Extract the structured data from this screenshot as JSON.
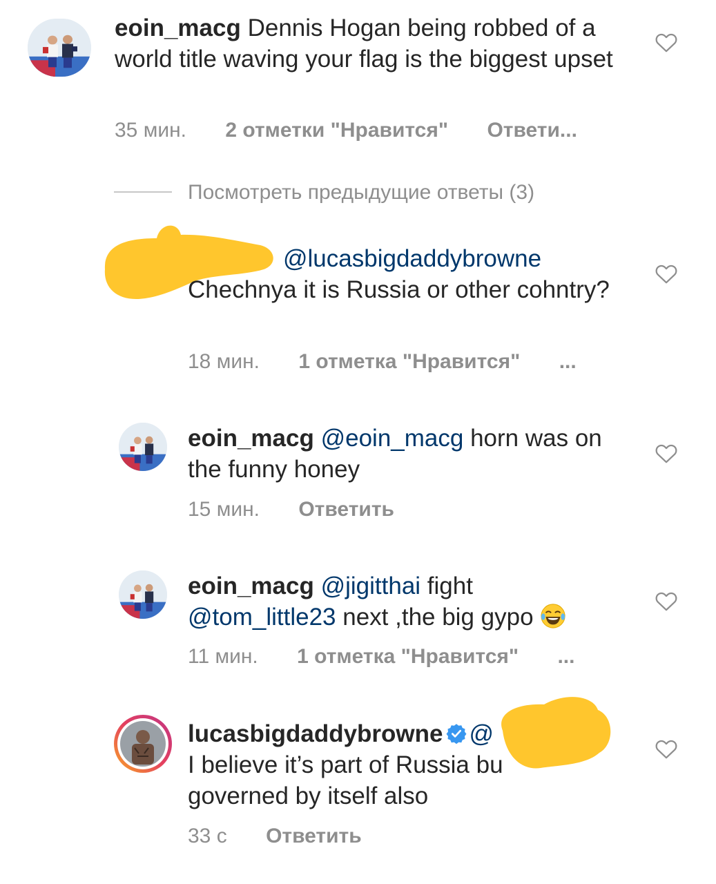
{
  "comments": [
    {
      "username": "eoin_macg",
      "text": "Dennis Hogan being robbed of a world title waving your flag is the biggest upset",
      "time": "35 мин.",
      "likes": "2 отметки \"Нравится\"",
      "reply": "Ответи..."
    },
    {
      "mention": "@lucasbigdaddybrowne",
      "text": "Chechnya it is Russia or other cohntry?",
      "time": "18 мин.",
      "likes": "1 отметка \"Нравится\"",
      "more": "..."
    },
    {
      "username": "eoin_macg",
      "mention": "@eoin_macg",
      "text": "horn was on the funny honey",
      "time": "15 мин.",
      "reply": "Ответить"
    },
    {
      "username": "eoin_macg",
      "mention": "@jigitthai",
      "text_a": " fight",
      "mention2": "@tom_little23",
      "text_b": " next ,the big gypo",
      "time": "11 мин.",
      "likes": "1 отметка \"Нравится\"",
      "more": "..."
    },
    {
      "username": "lucasbigdaddybrowne",
      "mention_partial": "@",
      "text_a": "I believe it’s part of Russia bu",
      "text_b": "governed by itself also",
      "time": "33 с",
      "reply": "Ответить"
    }
  ],
  "view_previous": "Посмотреть предыдущие ответы (3)",
  "icons": {
    "like": "heart-outline-icon",
    "verified": "verified-badge-icon",
    "emoji": "laughing-tears-emoji"
  },
  "colors": {
    "text": "#262626",
    "secondary": "#8e8e8e",
    "mention": "#00376b",
    "verified": "#3897f0",
    "redaction": "#ffc62d"
  }
}
